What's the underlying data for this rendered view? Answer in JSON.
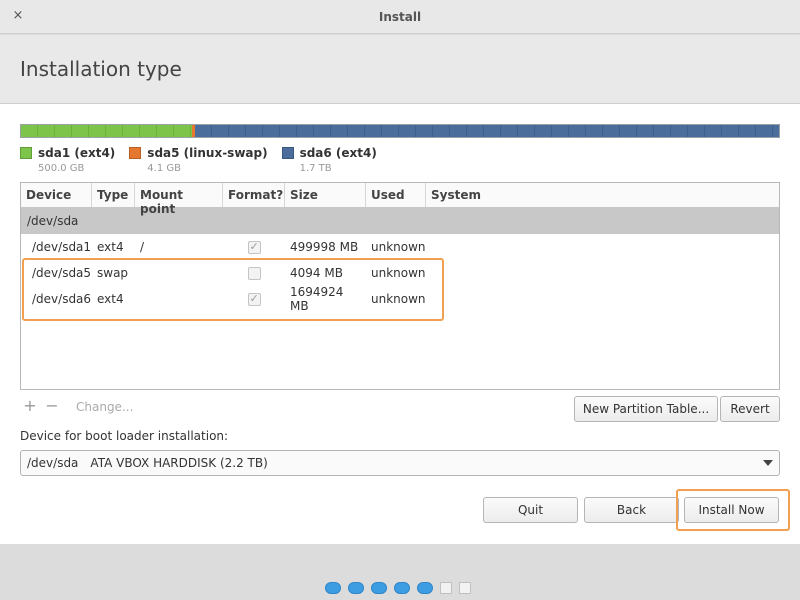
{
  "window": {
    "title": "Install",
    "close_glyph": "×"
  },
  "page": {
    "title": "Installation type"
  },
  "partition_bar": {
    "segments": [
      {
        "name": "sda1 (ext4)",
        "size": "500.0 GB",
        "color": "#7cc54a"
      },
      {
        "name": "sda5 (linux-swap)",
        "size": "4.1 GB",
        "color": "#e6772e"
      },
      {
        "name": "sda6 (ext4)",
        "size": "1.7 TB",
        "color": "#4a6d9c"
      }
    ]
  },
  "table": {
    "columns": [
      "Device",
      "Type",
      "Mount point",
      "Format?",
      "Size",
      "Used",
      "System"
    ],
    "group": "/dev/sda",
    "rows": [
      {
        "device": "/dev/sda1",
        "type": "ext4",
        "mount": "/",
        "format": true,
        "size": "499998 MB",
        "used": "unknown",
        "system": ""
      },
      {
        "device": "/dev/sda5",
        "type": "swap",
        "mount": "",
        "format": false,
        "size": "4094 MB",
        "used": "unknown",
        "system": ""
      },
      {
        "device": "/dev/sda6",
        "type": "ext4",
        "mount": "",
        "format": true,
        "size": "1694924 MB",
        "used": "unknown",
        "system": ""
      }
    ]
  },
  "tools": {
    "add": "+",
    "remove": "−",
    "change": "Change..."
  },
  "buttons": {
    "new_partition_table": "New Partition Table...",
    "revert": "Revert",
    "quit": "Quit",
    "back": "Back",
    "install_now": "Install Now"
  },
  "bootloader": {
    "label": "Device for boot loader installation:",
    "device": "/dev/sda",
    "description": "ATA VBOX HARDDISK (2.2 TB)"
  },
  "progress": {
    "total_steps": 7,
    "completed_steps": 5
  },
  "colors": {
    "highlight": "#f0a050",
    "progress_dot": "#3d9de3"
  }
}
